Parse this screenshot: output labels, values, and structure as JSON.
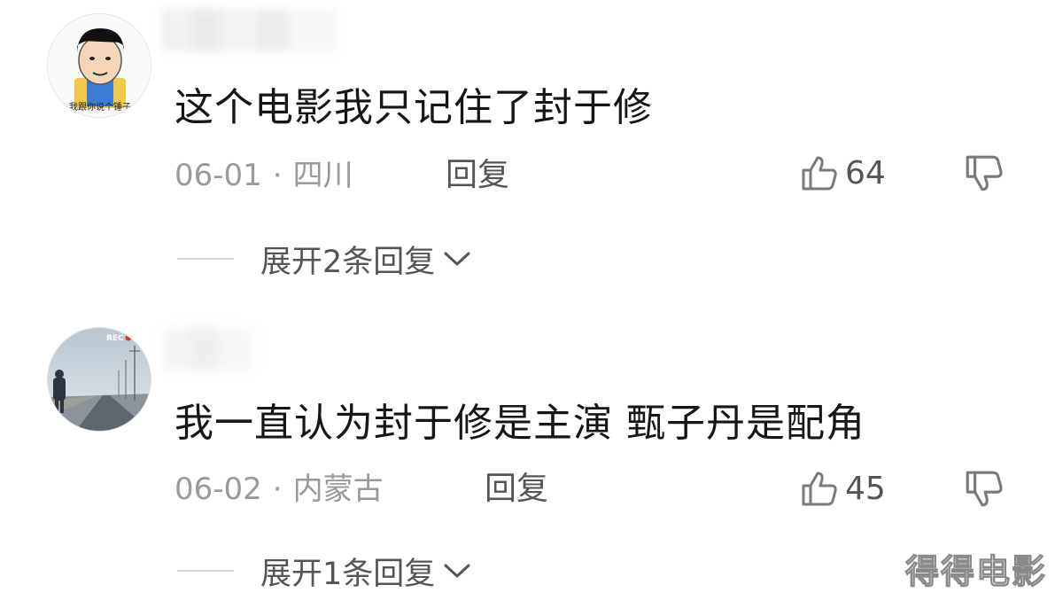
{
  "comments": [
    {
      "text": "这个电影我只记住了封于修",
      "date": "06-01",
      "separator": "·",
      "location": "四川",
      "reply_label": "回复",
      "likes": "64",
      "expand_label": "展开2条回复",
      "avatar_caption": "我跟你说个锤子"
    },
    {
      "text": "我一直认为封于修是主演 甄子丹是配角",
      "date": "06-02",
      "separator": "·",
      "location": "内蒙古",
      "reply_label": "回复",
      "likes": "45",
      "expand_label": "展开1条回复",
      "avatar_badge": "REC"
    }
  ],
  "watermark": "得得电影",
  "icons": {
    "like": "thumbs-up-icon",
    "dislike": "thumbs-down-icon",
    "expand": "chevron-down-icon"
  },
  "colors": {
    "text_primary": "#161616",
    "text_secondary": "#9a9a9a",
    "action": "#555555",
    "divider": "#d9d9d9"
  }
}
